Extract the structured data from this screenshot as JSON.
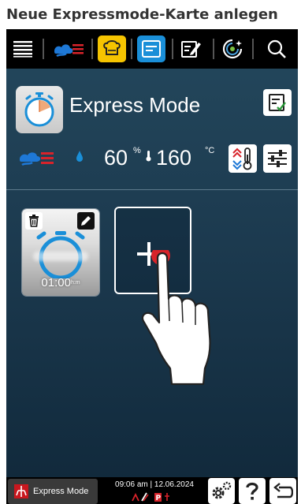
{
  "page_title": "Neue Expressmode-Karte anlegen",
  "toolbar": {
    "items": [
      "menu-icon",
      "climate-icon",
      "cook-mode-icon",
      "express-mode-icon",
      "notes-icon",
      "smart-icon",
      "search-icon"
    ],
    "active_item": "express-mode-icon"
  },
  "header": {
    "title": "Express Mode",
    "icon": "timer-icon"
  },
  "climate": {
    "humidity_value": "60",
    "humidity_unit": "%",
    "temperature_value": "160",
    "temperature_unit": "°C"
  },
  "card": {
    "time": "01:00",
    "time_unit": "h:m"
  },
  "add_card": {
    "icon": "plus-icon"
  },
  "bottom_bar": {
    "mode_label": "Express Mode",
    "time": "09:06 am",
    "date": "12.06.2024",
    "buttons": [
      "settings-icon",
      "help-icon",
      "back-icon"
    ]
  },
  "colors": {
    "accent_blue": "#1a8fd8",
    "accent_yellow": "#f5c400",
    "steam_red": "#d8232a",
    "steam_blue": "#1e78d6",
    "background_top": "#24485d",
    "background_bottom": "#10283a"
  }
}
